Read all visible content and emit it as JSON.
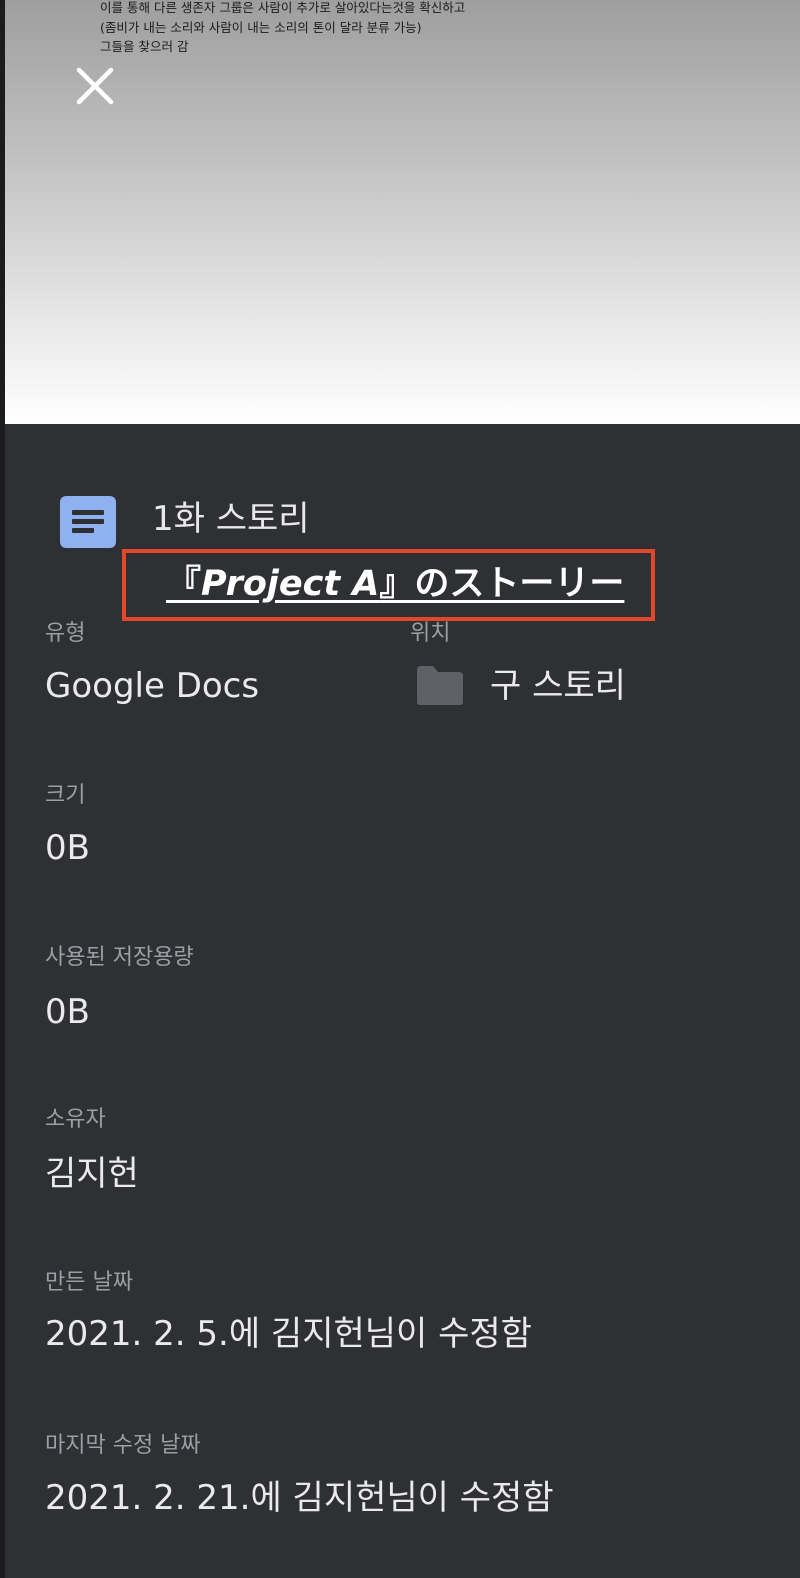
{
  "preview": {
    "lines": [
      "이를 통해 다른 생존자 그룹은 사람이 추가로 살아있다는것을 확신하고",
      "(좀비가 내는 소리와 사람이 내는 소리의 톤이 달라 분류 가능)",
      "그들을 찾으러 감"
    ]
  },
  "file": {
    "title": "1화 스토리",
    "highlight_prefix": "『",
    "highlight_italic": "Project A",
    "highlight_suffix": "』のストーリー"
  },
  "details": {
    "type_label": "유형",
    "type_value": "Google Docs",
    "location_label": "위치",
    "location_value": "구 스토리",
    "size_label": "크기",
    "size_value": "0B",
    "storage_label": "사용된 저장용량",
    "storage_value": "0B",
    "owner_label": "소유자",
    "owner_value": "김지헌",
    "created_label": "만든 날짜",
    "created_value": "2021. 2. 5.에 김지헌님이 수정함",
    "modified_label": "마지막 수정 날짜",
    "modified_value": "2021. 2. 21.에 김지헌님이 수정함"
  },
  "colors": {
    "panel_bg": "#2f3034",
    "doc_icon": "#8fb0f1",
    "highlight_border": "#e0472b",
    "label": "#9d9ea3",
    "value": "#eaeaea"
  },
  "icons": {
    "close": "close-icon",
    "doc": "google-docs-icon",
    "folder": "folder-icon"
  }
}
